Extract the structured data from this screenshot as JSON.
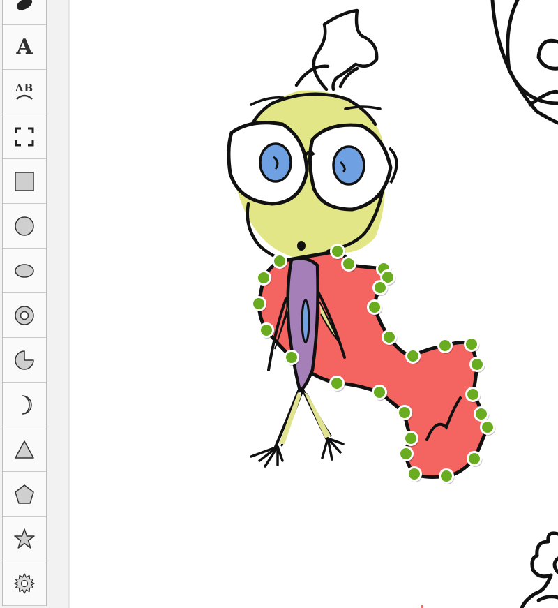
{
  "toolbar": {
    "tools": [
      {
        "icon": "brush-icon"
      },
      {
        "icon": "text-icon",
        "glyph": "A"
      },
      {
        "icon": "warp-text-icon",
        "glyph": "AB"
      },
      {
        "icon": "frame-icon"
      },
      {
        "icon": "square-icon"
      },
      {
        "icon": "circle-icon"
      },
      {
        "icon": "ellipse-icon"
      },
      {
        "icon": "ring-icon"
      },
      {
        "icon": "pie-icon"
      },
      {
        "icon": "crescent-icon"
      },
      {
        "icon": "triangle-icon"
      },
      {
        "icon": "pentagon-icon"
      },
      {
        "icon": "star-icon"
      },
      {
        "icon": "gear-icon"
      }
    ]
  },
  "colors": {
    "head_fill": "#e2e686",
    "scarf_fill": "#f46461",
    "eye_fill": "#6fa1e2",
    "body_fill": "#a47fb8",
    "leg_fill": "#e1e391",
    "handle_fill": "#6aac1f",
    "ink": "#111111"
  }
}
